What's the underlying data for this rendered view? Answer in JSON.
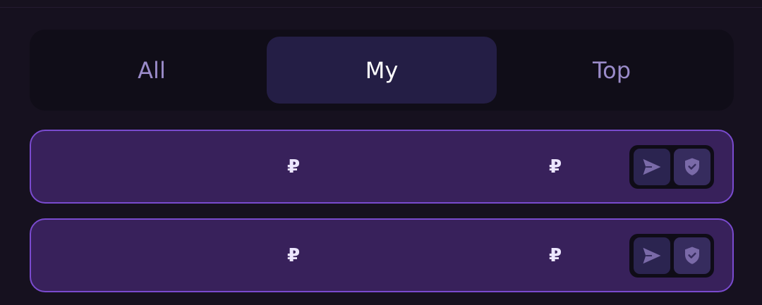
{
  "tabs": [
    {
      "label": "All",
      "active": false
    },
    {
      "label": "My",
      "active": true
    },
    {
      "label": "Top",
      "active": false
    }
  ],
  "rows": [
    {
      "amount_1": "₽",
      "amount_2": "₽",
      "actions": [
        "send-icon",
        "shield-check-icon"
      ]
    },
    {
      "amount_1": "₽",
      "amount_2": "₽",
      "actions": [
        "send-icon",
        "shield-check-icon"
      ]
    }
  ],
  "colors": {
    "background": "#16111f",
    "tabbar_bg": "#100d18",
    "tab_active_bg": "#241e45",
    "tab_text": "#9a8bc9",
    "row_bg": "#38215b",
    "row_border": "#7a4bcf"
  }
}
